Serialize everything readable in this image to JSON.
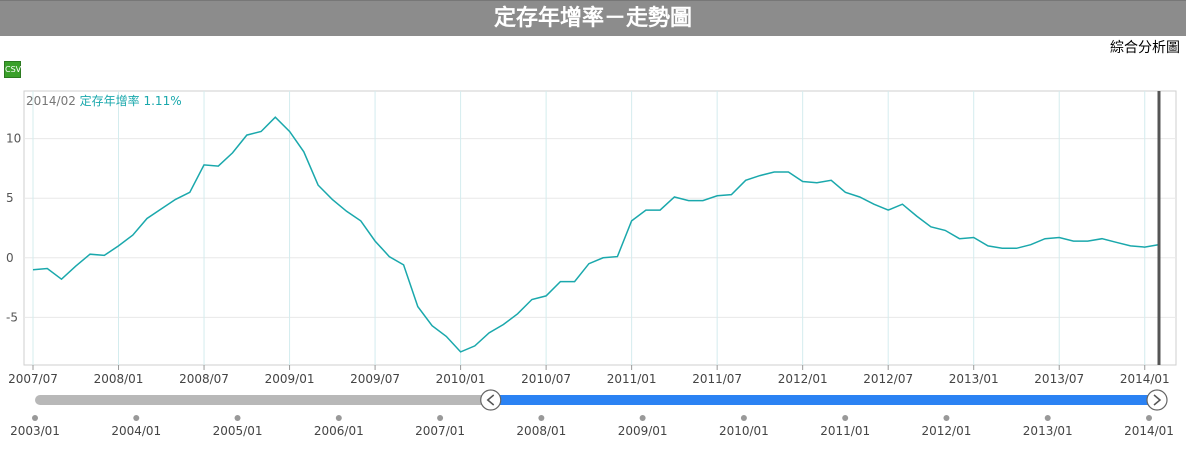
{
  "header": {
    "title": "定存年增率－走勢圖"
  },
  "toolbar": {
    "analysis_link": "綜合分析圖",
    "csv_label": "CSV"
  },
  "readout": {
    "date": "2014/02",
    "series": "定存年增率",
    "value": "1.11%"
  },
  "colors": {
    "line": "#1aa8ac",
    "header_bg": "#8c8c8c",
    "nav_blue": "#2b82f3",
    "nav_gray": "#b8b8b8"
  },
  "chart_data": {
    "type": "line",
    "series": [
      {
        "name": "定存年增率",
        "x": [
          "2007/07",
          "2007/08",
          "2007/09",
          "2007/10",
          "2007/11",
          "2007/12",
          "2008/01",
          "2008/02",
          "2008/03",
          "2008/04",
          "2008/05",
          "2008/06",
          "2008/07",
          "2008/08",
          "2008/09",
          "2008/10",
          "2008/11",
          "2008/12",
          "2009/01",
          "2009/02",
          "2009/03",
          "2009/04",
          "2009/05",
          "2009/06",
          "2009/07",
          "2009/08",
          "2009/09",
          "2009/10",
          "2009/11",
          "2009/12",
          "2010/01",
          "2010/02",
          "2010/03",
          "2010/04",
          "2010/05",
          "2010/06",
          "2010/07",
          "2010/08",
          "2010/09",
          "2010/10",
          "2010/11",
          "2010/12",
          "2011/01",
          "2011/02",
          "2011/03",
          "2011/04",
          "2011/05",
          "2011/06",
          "2011/07",
          "2011/08",
          "2011/09",
          "2011/10",
          "2011/11",
          "2011/12",
          "2012/01",
          "2012/02",
          "2012/03",
          "2012/04",
          "2012/05",
          "2012/06",
          "2012/07",
          "2012/08",
          "2012/09",
          "2012/10",
          "2012/11",
          "2012/12",
          "2013/01",
          "2013/02",
          "2013/03",
          "2013/04",
          "2013/05",
          "2013/06",
          "2013/07",
          "2013/08",
          "2013/09",
          "2013/10",
          "2013/11",
          "2013/12",
          "2014/01",
          "2014/02"
        ],
        "values": [
          -1.0,
          -0.9,
          -1.8,
          -0.7,
          0.3,
          0.2,
          1.0,
          1.9,
          3.3,
          4.1,
          4.9,
          5.5,
          7.8,
          7.7,
          8.8,
          10.3,
          10.6,
          11.8,
          10.6,
          8.9,
          6.1,
          4.9,
          3.9,
          3.1,
          1.4,
          0.1,
          -0.6,
          -4.1,
          -5.7,
          -6.6,
          -7.9,
          -7.4,
          -6.3,
          -5.6,
          -4.7,
          -3.5,
          -3.2,
          -2.0,
          -2.0,
          -0.5,
          0.0,
          0.1,
          3.1,
          4.0,
          4.0,
          5.1,
          4.8,
          4.8,
          5.2,
          5.3,
          6.5,
          6.9,
          7.2,
          7.2,
          6.4,
          6.3,
          6.5,
          5.5,
          5.1,
          4.5,
          4.0,
          4.5,
          3.5,
          2.6,
          2.3,
          1.6,
          1.7,
          1.0,
          0.8,
          0.8,
          1.1,
          1.6,
          1.7,
          1.4,
          1.4,
          1.6,
          1.3,
          1.0,
          0.9,
          1.11
        ]
      }
    ],
    "x_ticks": [
      "2007/07",
      "2008/01",
      "2008/07",
      "2009/01",
      "2009/07",
      "2010/01",
      "2010/07",
      "2011/01",
      "2011/07",
      "2012/01",
      "2012/07",
      "2013/01",
      "2013/07",
      "2014/01"
    ],
    "y_ticks": [
      10,
      5,
      0,
      -5
    ],
    "ylim": [
      -9,
      14
    ],
    "grid": true,
    "navigator": {
      "x_ticks": [
        "2003/01",
        "2004/01",
        "2005/01",
        "2006/01",
        "2007/01",
        "2008/01",
        "2009/01",
        "2010/01",
        "2011/01",
        "2012/01",
        "2013/01",
        "2014/01"
      ],
      "range": [
        "2007/07",
        "2014/02"
      ]
    }
  }
}
